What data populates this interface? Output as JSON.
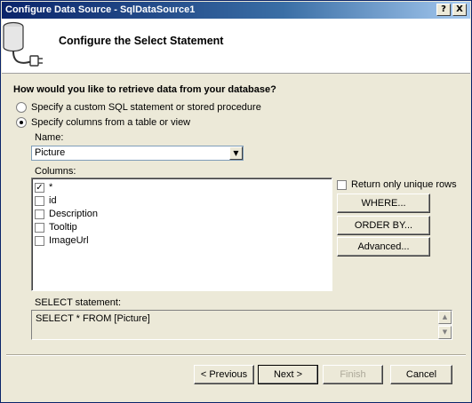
{
  "window": {
    "title": "Configure Data Source - SqlDataSource1",
    "help_glyph": "?",
    "close_glyph": "X"
  },
  "header": {
    "title": "Configure the Select Statement",
    "icon": "database-plug-icon"
  },
  "question": "How would you like to retrieve data from your database?",
  "options": [
    {
      "label": "Specify a custom SQL statement or stored procedure",
      "selected": false
    },
    {
      "label": "Specify columns from a table or view",
      "selected": true
    }
  ],
  "name": {
    "label": "Name:",
    "value": "Picture",
    "arrow": "▼"
  },
  "columns": {
    "label": "Columns:",
    "items": [
      {
        "label": "*",
        "checked": true
      },
      {
        "label": "id",
        "checked": false
      },
      {
        "label": "Description",
        "checked": false
      },
      {
        "label": "Tooltip",
        "checked": false
      },
      {
        "label": "ImageUrl",
        "checked": false
      }
    ]
  },
  "unique_rows": {
    "label": "Return only unique rows",
    "checked": false
  },
  "side_buttons": {
    "where": "WHERE...",
    "order_by": "ORDER BY...",
    "advanced": "Advanced..."
  },
  "select_statement": {
    "label": "SELECT statement:",
    "value": "SELECT * FROM [Picture]",
    "up": "▲",
    "down": "▼"
  },
  "nav": {
    "previous": "< Previous",
    "next": "Next >",
    "finish": "Finish",
    "cancel": "Cancel"
  },
  "colors": {
    "title_start": "#0A246A",
    "title_end": "#A6CAF0",
    "face": "#ECE9D8"
  }
}
